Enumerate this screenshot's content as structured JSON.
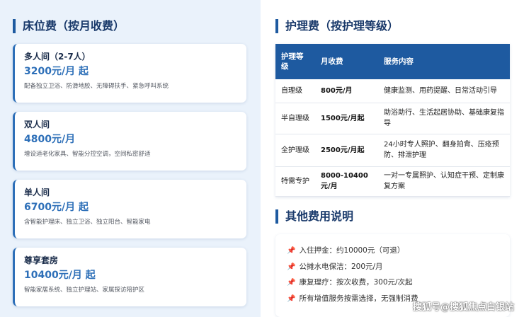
{
  "left": {
    "title": "床位费（按月收费）",
    "rooms": [
      {
        "name": "多人间（2-7人）",
        "price": "3200元/月 起",
        "desc": "配备独立卫浴、防滑地胶、无障碍扶手、紧急呼叫系统"
      },
      {
        "name": "双人间",
        "price": "4800元/月",
        "desc": "增设适老化家具、智能分控空调，空间私密舒适"
      },
      {
        "name": "单人间",
        "price": "6700元/月 起",
        "desc": "含智能护理床、独立卫浴、独立阳台、智能家电"
      },
      {
        "name": "尊享套房",
        "price": "10400元/月 起",
        "desc": "智能家居系统、独立护理站、家属探访陪护区"
      }
    ]
  },
  "right": {
    "title": "护理费（按护理等级）",
    "table": {
      "headers": [
        "护理等级",
        "月收费",
        "服务内容"
      ],
      "rows": [
        [
          "自理级",
          "800元/月",
          "健康监测、用药提醒、日常活动引导"
        ],
        [
          "半自理级",
          "1500元/月起",
          "助浴助行、生活起居协助、基础康复指导"
        ],
        [
          "全护理级",
          "2500元/月起",
          "24小时专人照护、翻身拍背、压疮预防、排泄护理"
        ],
        [
          "特需专护",
          "8000-10400元/月",
          "一对一专属照护、认知症干预、定制康复方案"
        ]
      ]
    },
    "other_title": "其他费用说明",
    "other_items": [
      "入住押金：约10000元（可退）",
      "公摊水电保洁：200元/月",
      "康复理疗：按次收费，300元/次起",
      "所有增值服务按需选择，无强制消费"
    ]
  },
  "watermark": "搜狐号@搜狐焦点白银站"
}
